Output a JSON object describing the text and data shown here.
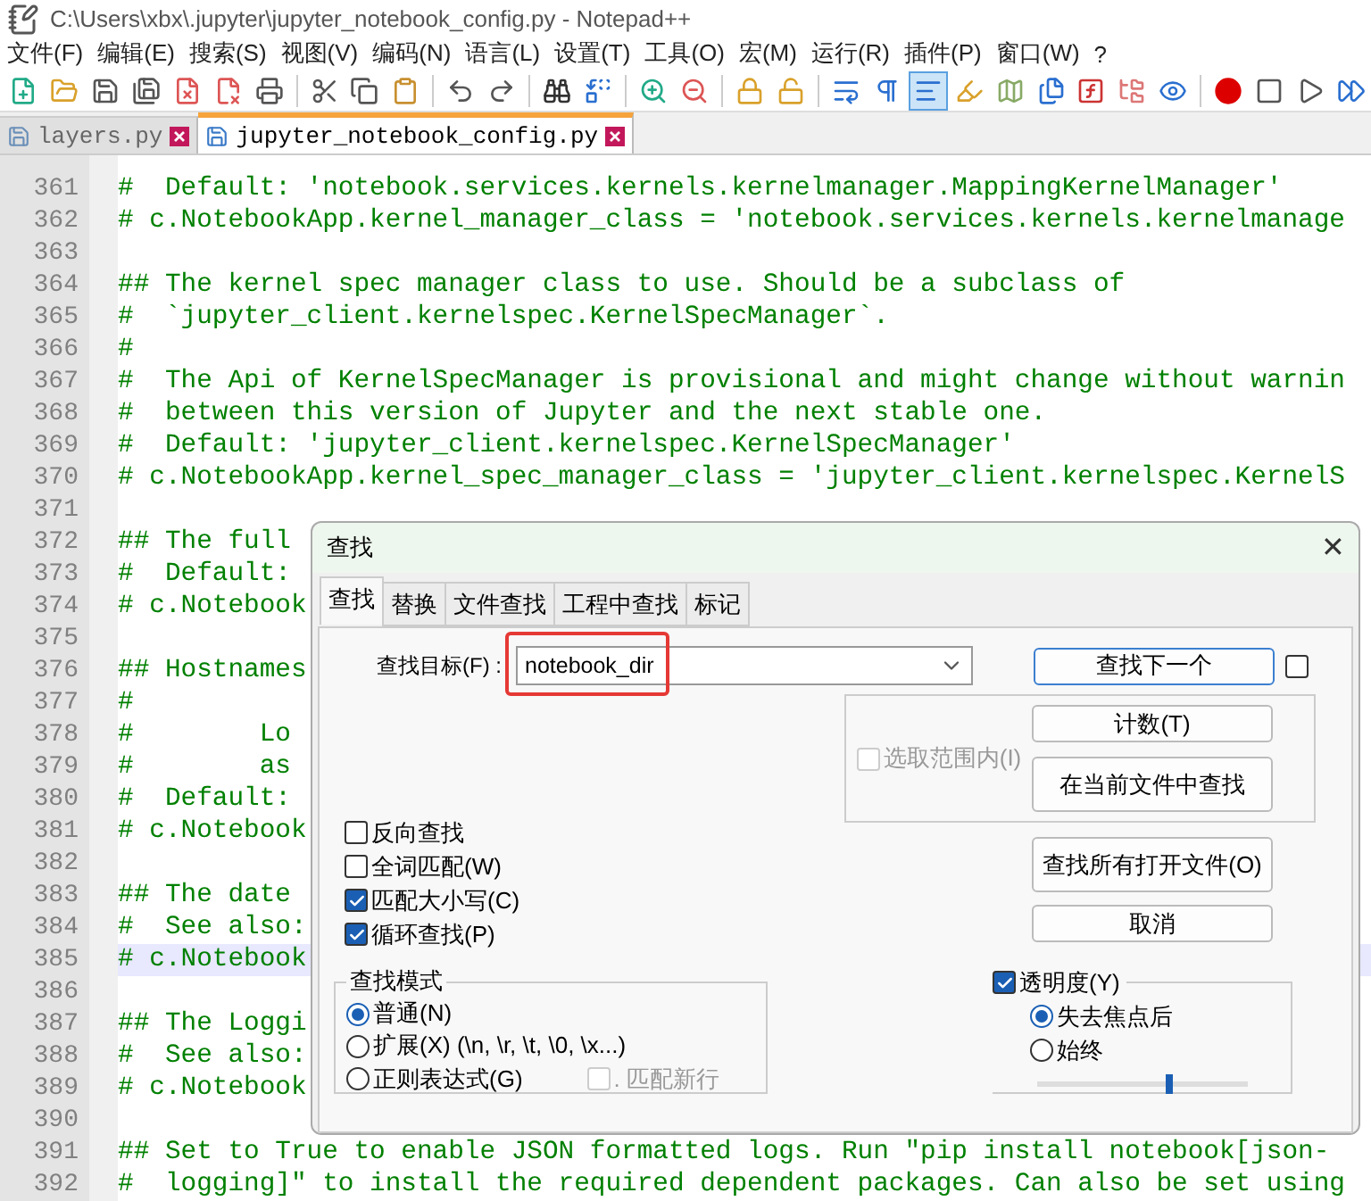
{
  "window": {
    "title": "C:\\Users\\xbx\\.jupyter\\jupyter_notebook_config.py - Notepad++"
  },
  "menu": [
    "文件(F)",
    "编辑(E)",
    "搜索(S)",
    "视图(V)",
    "编码(N)",
    "语言(L)",
    "设置(T)",
    "工具(O)",
    "宏(M)",
    "运行(R)",
    "插件(P)",
    "窗口(W)",
    "?"
  ],
  "toolbar": [
    {
      "pressed": false
    },
    {
      "pressed": false
    },
    {
      "pressed": false
    },
    {
      "pressed": false
    },
    {
      "pressed": false
    },
    {
      "pressed": false
    },
    {
      "pressed": false
    },
    {
      "pressed": false
    },
    {
      "pressed": false
    },
    {
      "pressed": false
    },
    {
      "pressed": false
    },
    {
      "pressed": false
    },
    {
      "pressed": false
    },
    {
      "pressed": false
    },
    {
      "pressed": false
    },
    {
      "pressed": false
    },
    {
      "pressed": false
    },
    {
      "pressed": false
    },
    {
      "pressed": false
    },
    {
      "pressed": false
    },
    {
      "pressed": true
    },
    {
      "pressed": false
    },
    {
      "pressed": false
    },
    {
      "pressed": false
    },
    {
      "pressed": false
    },
    {
      "pressed": false
    },
    {
      "pressed": false
    },
    {
      "pressed": false
    },
    {
      "pressed": false
    },
    {
      "pressed": false
    },
    {
      "pressed": false
    }
  ],
  "tabs": [
    {
      "label": "layers.py",
      "selected": false
    },
    {
      "label": "jupyter_notebook_config.py",
      "selected": true
    }
  ],
  "editor": {
    "lines": [
      {
        "number": "361",
        "text": "#  Default: 'notebook.services.kernels.kernelmanager.MappingKernelManager'",
        "current": false
      },
      {
        "number": "362",
        "text": "# c.NotebookApp.kernel_manager_class = 'notebook.services.kernels.kernelmanage",
        "current": false
      },
      {
        "number": "363",
        "current": false
      },
      {
        "number": "364",
        "text": "## The kernel spec manager class to use. Should be a subclass of",
        "current": false
      },
      {
        "number": "365",
        "text": "#  `jupyter_client.kernelspec.KernelSpecManager`.",
        "current": false
      },
      {
        "number": "366",
        "text": "#",
        "current": false
      },
      {
        "number": "367",
        "text": "#  The Api of KernelSpecManager is provisional and might change without warnin",
        "current": false
      },
      {
        "number": "368",
        "text": "#  between this version of Jupyter and the next stable one.",
        "current": false
      },
      {
        "number": "369",
        "text": "#  Default: 'jupyter_client.kernelspec.KernelSpecManager'",
        "current": false
      },
      {
        "number": "370",
        "text": "# c.NotebookApp.kernel_spec_manager_class = 'jupyter_client.kernelspec.KernelS",
        "current": false
      },
      {
        "number": "371",
        "current": false
      },
      {
        "number": "372",
        "text": "## The full",
        "current": false
      },
      {
        "number": "373",
        "text": "#  Default:",
        "current": false
      },
      {
        "number": "374",
        "text": "# c.Notebook",
        "current": false
      },
      {
        "number": "375",
        "current": false
      },
      {
        "number": "376",
        "text": "## Hostnames",
        "current": false
      },
      {
        "number": "377",
        "text": "#",
        "current": false
      },
      {
        "number": "378",
        "text": "#        Lo",
        "current": false
      },
      {
        "number": "379",
        "text": "#        as",
        "current": false
      },
      {
        "number": "380",
        "text": "#  Default:",
        "current": false
      },
      {
        "number": "381",
        "text": "# c.Notebook",
        "current": false
      },
      {
        "number": "382",
        "current": false
      },
      {
        "number": "383",
        "text": "## The date",
        "current": false
      },
      {
        "number": "384",
        "text": "#  See also:",
        "current": false
      },
      {
        "number": "385",
        "text": "# c.Notebook",
        "current": true
      },
      {
        "number": "386",
        "current": false
      },
      {
        "number": "387",
        "text": "## The Loggi",
        "current": false
      },
      {
        "number": "388",
        "text": "#  See also:",
        "current": false
      },
      {
        "number": "389",
        "text": "# c.Notebook",
        "current": false
      },
      {
        "number": "390",
        "current": false
      },
      {
        "number": "391",
        "text": "## Set to True to enable JSON formatted logs. Run \"pip install notebook[json-",
        "current": false
      },
      {
        "number": "392",
        "text": "#  logging]\" to install the required dependent packages. Can also be set using",
        "current": false
      }
    ]
  },
  "find_dialog": {
    "title": "查找",
    "close": "✕",
    "tabs": [
      {
        "label": "查找",
        "selected": true
      },
      {
        "label": "替换",
        "selected": false
      },
      {
        "label": "文件查找",
        "selected": false
      },
      {
        "label": "工程中查找",
        "selected": false
      },
      {
        "label": "标记",
        "selected": false
      }
    ],
    "search_label": "查找目标(F) :",
    "search_value": "notebook_dir",
    "find_next": "查找下一个",
    "find_next_option_checked": false,
    "in_selection": {
      "label": "选取范围内(I)",
      "checked": false,
      "disabled": true
    },
    "count": "计数(T)",
    "find_in_current": "在当前文件中查找",
    "find_in_all": "查找所有打开文件(O)",
    "cancel": "取消",
    "options": [
      {
        "label": "反向查找",
        "checked": false
      },
      {
        "label": "全词匹配(W)",
        "checked": false
      },
      {
        "label": "匹配大小写(C)",
        "checked": true
      },
      {
        "label": "循环查找(P)",
        "checked": true
      }
    ],
    "search_mode": {
      "title": "查找模式",
      "modes": [
        {
          "label": "普通(N)",
          "selected": true
        },
        {
          "label": "扩展(X) (\\n, \\r, \\t, \\0, \\x...)",
          "selected": false
        },
        {
          "label": "正则表达式(G)",
          "selected": false
        }
      ],
      "dot_newline": {
        "label": ". 匹配新行",
        "checked": false,
        "disabled": true
      }
    },
    "transparency": {
      "label": "透明度(Y)",
      "checked": true,
      "modes": [
        {
          "label": "失去焦点后",
          "selected": true
        },
        {
          "label": "始终",
          "selected": false
        }
      ],
      "level": 0.63
    }
  }
}
